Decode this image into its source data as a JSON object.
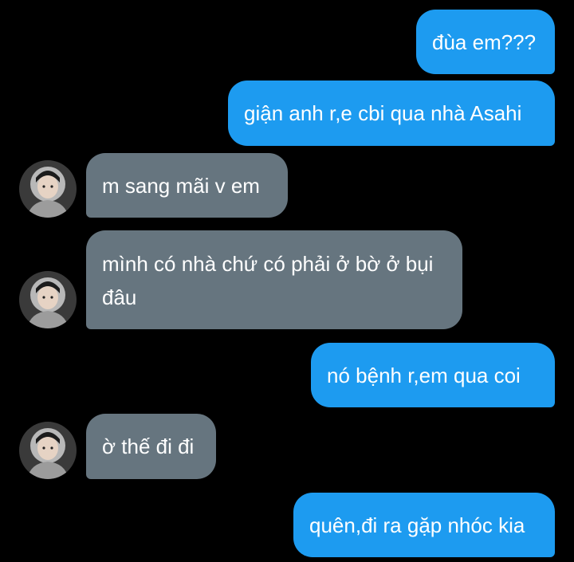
{
  "conversation": {
    "messages": [
      {
        "sender": "me",
        "text": "đùa em???"
      },
      {
        "sender": "me",
        "text": "giận anh r,e cbi qua nhà Asahi"
      },
      {
        "sender": "other",
        "text": "m sang mãi v em"
      },
      {
        "sender": "other",
        "text": "mình có nhà chứ có phải ở bờ ở bụi đâu"
      },
      {
        "sender": "me",
        "text": "nó bệnh r,em qua coi"
      },
      {
        "sender": "other",
        "text": "ờ thế đi đi"
      },
      {
        "sender": "me",
        "text": "quên,đi ra gặp nhóc kia"
      }
    ]
  },
  "colors": {
    "background": "#000000",
    "sent_bubble": "#1d9bf0",
    "received_bubble": "#66757f",
    "text": "#ffffff"
  },
  "icons": {
    "avatar": "profile-photo-avatar"
  }
}
